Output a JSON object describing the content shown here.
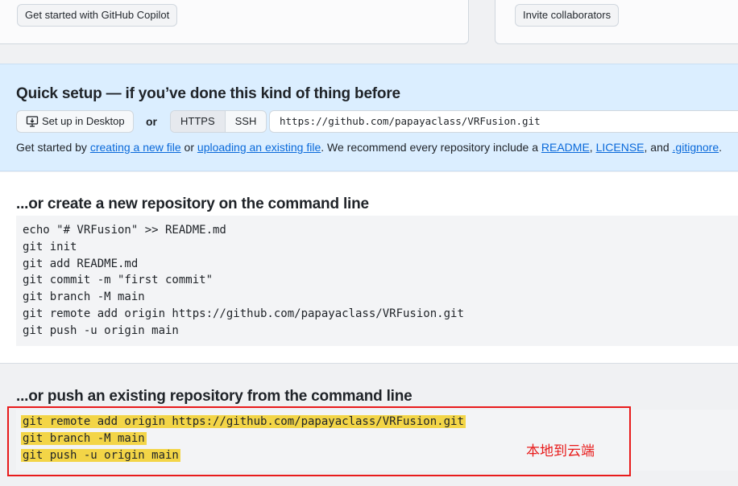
{
  "top": {
    "copilot_button": "Get started with GitHub Copilot",
    "invite_button": "Invite collaborators"
  },
  "quick_setup": {
    "title": "Quick setup — if you’ve done this kind of thing before",
    "desktop_button": "Set up in Desktop",
    "or": "or",
    "https": "HTTPS",
    "ssh": "SSH",
    "url": "https://github.com/papayaclass/VRFusion.git",
    "get_started": {
      "prefix": "Get started by ",
      "link_new_file": "creating a new file",
      "or": " or ",
      "link_upload": "uploading an existing file",
      "middle": ". We recommend every repository include a ",
      "link_readme": "README",
      "comma": ", ",
      "link_license": "LICENSE",
      "and": ", and ",
      "link_gitignore": ".gitignore",
      "suffix": "."
    }
  },
  "new_repo": {
    "title": "...or create a new repository on the command line",
    "lines": [
      "echo \"# VRFusion\" >> README.md",
      "git init",
      "git add README.md",
      "git commit -m \"first commit\"",
      "git branch -M main",
      "git remote add origin https://github.com/papayaclass/VRFusion.git",
      "git push -u origin main"
    ]
  },
  "push_existing": {
    "title": "...or push an existing repository from the command line",
    "lines": [
      "git remote add origin https://github.com/papayaclass/VRFusion.git",
      "git branch -M main",
      "git push -u origin main"
    ]
  },
  "annotation": {
    "note": "本地到云端",
    "color": "#e81b1b",
    "highlight_color": "#f3d547"
  }
}
